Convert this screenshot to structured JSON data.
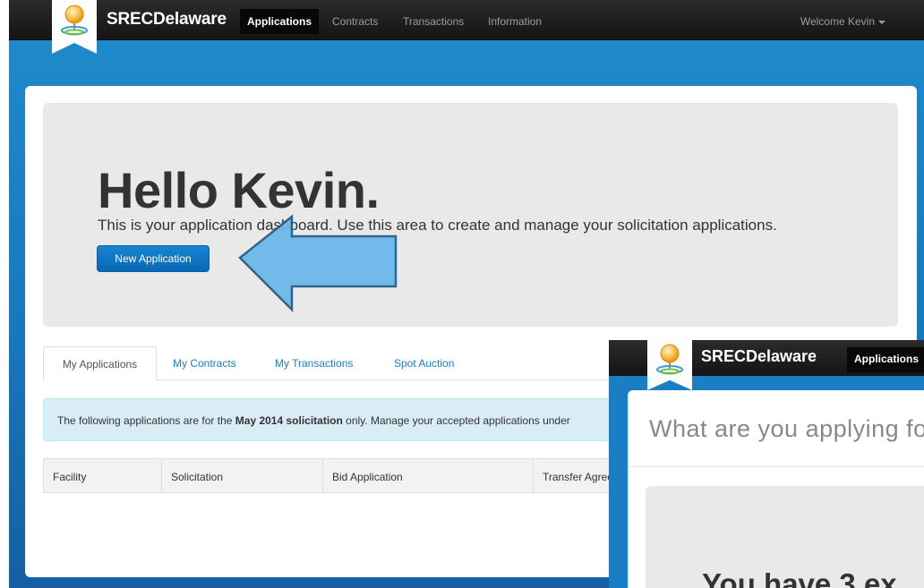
{
  "navbar": {
    "brand": "SRECDelaware",
    "links": [
      "Applications",
      "Contracts",
      "Transactions",
      "Information"
    ],
    "active_link": "Applications",
    "user_menu": "Welcome Kevin"
  },
  "jumbotron": {
    "heading": "Hello Kevin.",
    "lead": "This is your application dashboard. Use this area to create and manage your solicitation applications.",
    "new_button": "New Application"
  },
  "tabs": [
    "My Applications",
    "My Contracts",
    "My Transactions",
    "Spot Auction"
  ],
  "alert": {
    "prefix": "The following applications are for the ",
    "bold": "May 2014 solicitation",
    "suffix": " only. Manage your accepted applications under"
  },
  "table": {
    "headers": [
      "Facility",
      "Solicitation",
      "Bid Application",
      "Transfer Agreement"
    ]
  },
  "overlay": {
    "brand": "SRECDelaware",
    "nav_active": "Applications",
    "heading": "What are you applying for?",
    "big_text": "You have 3 ex"
  },
  "colors": {
    "accent": "#1a80c5",
    "navbar": "#1b1b1b",
    "background": "#1978bd",
    "annotation_arrow": "#6cb8e9"
  }
}
